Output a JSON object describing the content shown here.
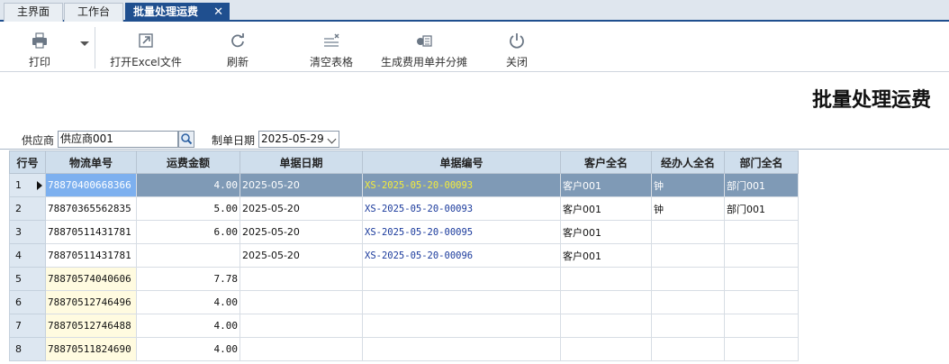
{
  "tabs": [
    {
      "label": "主界面"
    },
    {
      "label": "工作台"
    },
    {
      "label": "批量处理运费",
      "close": "✕"
    }
  ],
  "toolbar": {
    "print": "打印",
    "open_excel": "打开Excel文件",
    "refresh": "刷新",
    "clear_table": "清空表格",
    "generate_bill": "生成费用单并分摊",
    "close": "关闭"
  },
  "page_title": "批量处理运费",
  "filters": {
    "supplier_label": "供应商",
    "supplier_value": "供应商001",
    "date_label": "制单日期",
    "date_value": "2025-05-29"
  },
  "table": {
    "headers": [
      "行号",
      "物流单号",
      "运费金额",
      "单据日期",
      "单据编号",
      "客户全名",
      "经办人全名",
      "部门全名"
    ],
    "rows": [
      {
        "no": "1",
        "waybill": "78870400668366",
        "amount": "4.00",
        "date": "2025-05-20",
        "bill_no": "XS-2025-05-20-00093",
        "customer": "客户001",
        "handler": "钟",
        "dept": "部门001"
      },
      {
        "no": "2",
        "waybill": "78870365562835",
        "amount": "5.00",
        "date": "2025-05-20",
        "bill_no": "XS-2025-05-20-00093",
        "customer": "客户001",
        "handler": "钟",
        "dept": "部门001"
      },
      {
        "no": "3",
        "waybill": "78870511431781",
        "amount": "6.00",
        "date": "2025-05-20",
        "bill_no": "XS-2025-05-20-00095",
        "customer": "客户001",
        "handler": "",
        "dept": ""
      },
      {
        "no": "4",
        "waybill": "78870511431781",
        "amount": "",
        "date": "2025-05-20",
        "bill_no": "XS-2025-05-20-00096",
        "customer": "客户001",
        "handler": "",
        "dept": ""
      },
      {
        "no": "5",
        "waybill": "78870574040606",
        "amount": "7.78",
        "date": "",
        "bill_no": "",
        "customer": "",
        "handler": "",
        "dept": ""
      },
      {
        "no": "6",
        "waybill": "78870512746496",
        "amount": "4.00",
        "date": "",
        "bill_no": "",
        "customer": "",
        "handler": "",
        "dept": ""
      },
      {
        "no": "7",
        "waybill": "78870512746488",
        "amount": "4.00",
        "date": "",
        "bill_no": "",
        "customer": "",
        "handler": "",
        "dept": ""
      },
      {
        "no": "8",
        "waybill": "78870511824690",
        "amount": "4.00",
        "date": "",
        "bill_no": "",
        "customer": "",
        "handler": "",
        "dept": ""
      }
    ]
  },
  "colors": {
    "accent": "#1f4f8f",
    "selected_row": "#7f9ab6",
    "selected_cell": "#7db0ef",
    "bill_text": "#1a3a9c",
    "selected_bill_text": "#f4ec3a",
    "unmatched_cell": "#fffbe0"
  },
  "icons": {
    "print": "printer-icon",
    "open_excel": "open-file-icon",
    "refresh": "refresh-icon",
    "clear_table": "clear-table-icon",
    "generate_bill": "bill-icon",
    "close": "power-icon",
    "lookup": "magnifier-icon"
  }
}
